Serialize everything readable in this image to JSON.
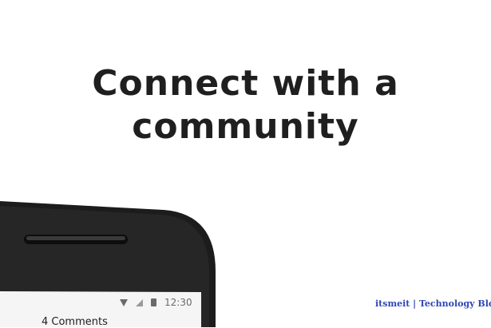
{
  "headline": {
    "line1": "Connect with a",
    "line2": "community"
  },
  "phone": {
    "status_time": "12:30",
    "icons": [
      "wifi-icon",
      "signal-icon",
      "battery-icon"
    ],
    "comments_label": "4 Comments"
  },
  "watermark": "itsmeit | Technology Blogs",
  "colors": {
    "background": "#ffffff",
    "text": "#1f1f1f",
    "phone_body": "#1c1c1c",
    "screen": "#f5f5f5",
    "watermark": "#2f46b5"
  }
}
